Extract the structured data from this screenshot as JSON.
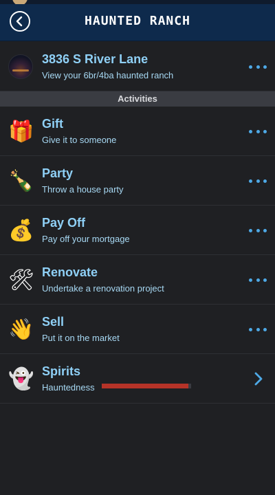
{
  "header": {
    "title": "HAUNTED RANCH"
  },
  "property": {
    "address": "3836 S River Lane",
    "description": "View your 6br/4ba haunted ranch"
  },
  "section_label": "Activities",
  "activities": [
    {
      "title": "Gift",
      "subtitle": "Give it to someone",
      "icon": "gift-emoji"
    },
    {
      "title": "Party",
      "subtitle": "Throw a house party",
      "icon": "champagne-emoji"
    },
    {
      "title": "Pay Off",
      "subtitle": "Pay off your mortgage",
      "icon": "money-bag-emoji"
    },
    {
      "title": "Renovate",
      "subtitle": "Undertake a renovation project",
      "icon": "hammer-wrench-emoji"
    },
    {
      "title": "Sell",
      "subtitle": "Put it on the market",
      "icon": "waving-hand-emoji"
    }
  ],
  "spirits": {
    "title": "Spirits",
    "subtitle": "Hauntedness",
    "hauntedness_percent": 97,
    "icon": "ghost-emoji"
  },
  "colors": {
    "header_bg": "#0e2a4c",
    "title_text": "#8fd0f6",
    "accent": "#4ea9e6",
    "meter_fill": "#b53328"
  }
}
